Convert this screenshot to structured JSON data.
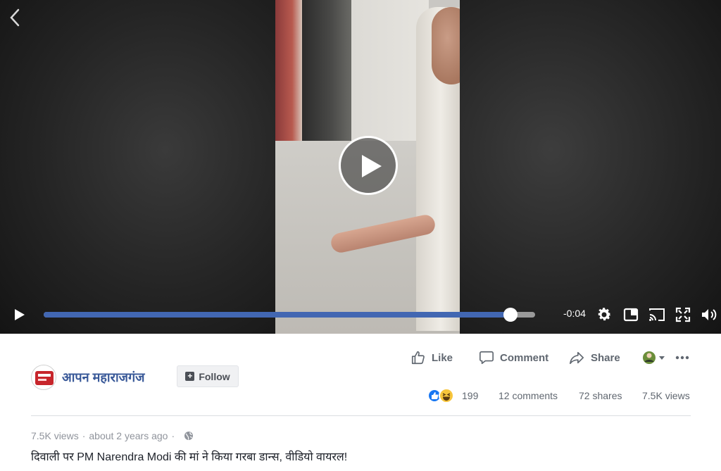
{
  "player": {
    "time_remaining": "-0:04",
    "progress": 0.95
  },
  "actions": {
    "like": "Like",
    "comment": "Comment",
    "share": "Share"
  },
  "page": {
    "name": "आपन महाराजगंज",
    "follow_label": "Follow"
  },
  "stats": {
    "reactions": "199",
    "comments": "12 comments",
    "shares": "72 shares",
    "views": "7.5K views"
  },
  "meta": {
    "views": "7.5K views",
    "time": "about 2 years ago"
  },
  "video_title": "दिवाली पर PM Narendra Modi की मां ने किया गरबा डान्स, वीडियो वायरल!",
  "colors": {
    "accent": "#4267b2",
    "page_link": "#385898"
  }
}
